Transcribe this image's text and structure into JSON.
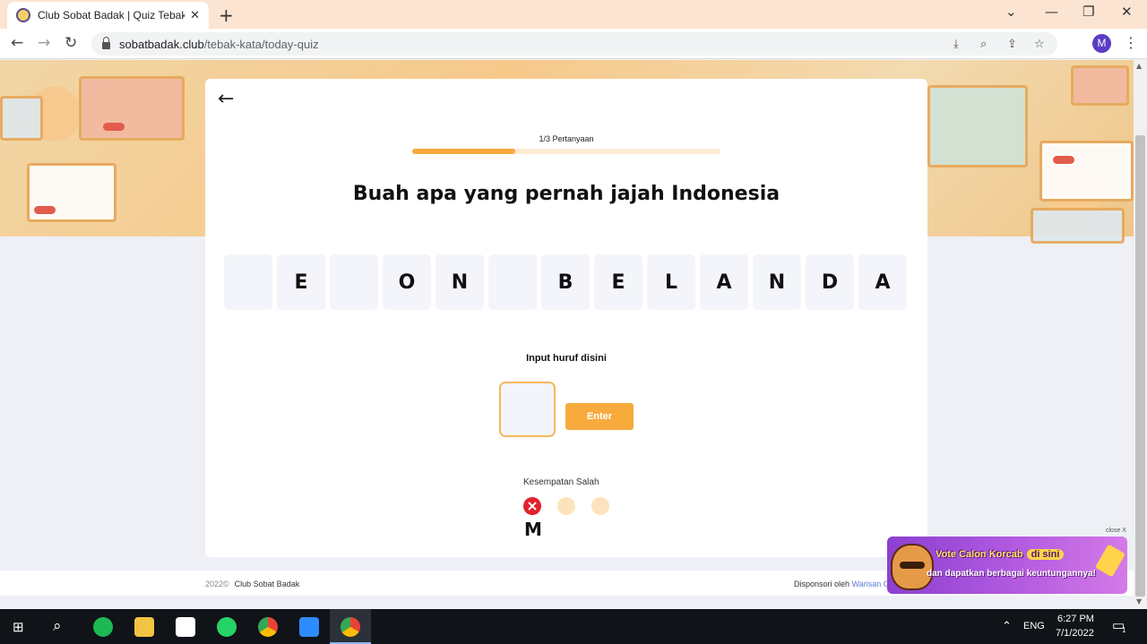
{
  "browser": {
    "tab_title": "Club Sobat Badak | Quiz Tebak Kata",
    "tab_close": "✕",
    "new_tab": "+",
    "window_controls": {
      "minimize": "—",
      "maximize": "❐",
      "close": "✕"
    },
    "url_host": "sobatbadak.club",
    "url_path": "/tebak-kata/today-quiz",
    "profile_initial": "M"
  },
  "quiz": {
    "back_icon": "←",
    "progress_text": "1/3 Pertanyaan",
    "progress_fraction": 0.333,
    "question": "Buah apa yang pernah jajah Indonesia",
    "answer_slots": [
      "",
      "E",
      "",
      "O",
      "N",
      "",
      "B",
      "E",
      "L",
      "A",
      "N",
      "D",
      "A"
    ],
    "input_label": "Input huruf disini",
    "input_value": "",
    "enter_label": "Enter",
    "chances_label": "Kesempatan Salah",
    "chances_total": 3,
    "chances_used": 1,
    "wrong_letters": "M"
  },
  "footer": {
    "year": "2022©",
    "brand": "Club Sobat Badak",
    "sponsor_prefix": "Disponsori oleh",
    "sponsor_link": "Warisan G"
  },
  "ad": {
    "close_text": "close X",
    "line1": "Vote Calon Korcab",
    "chip": "di sini",
    "line2": "dan dapatkan berbagai keuntungannya!"
  },
  "taskbar": {
    "lang": "ENG",
    "time": "6:27 PM",
    "date": "7/1/2022",
    "notification_count": "1"
  },
  "colors": {
    "accent": "#f7ab3d",
    "progress_track": "#fdebd2",
    "error": "#e1222b",
    "slot_bg": "#f3f5fa"
  }
}
